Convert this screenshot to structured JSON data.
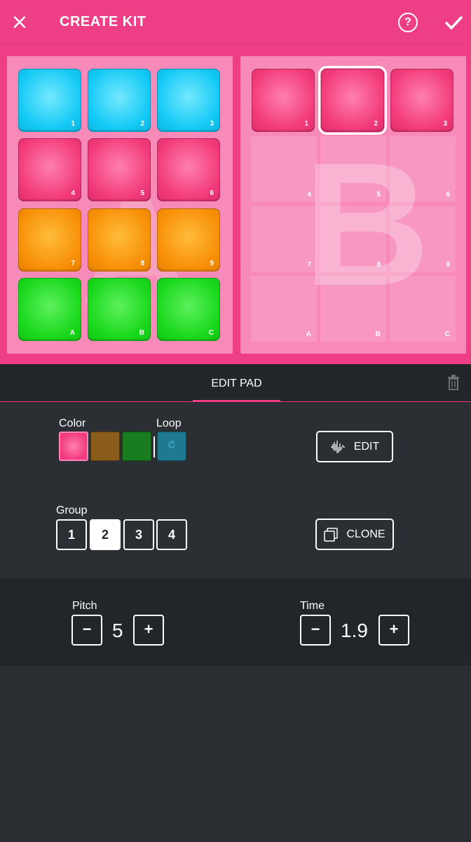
{
  "header": {
    "title": "CREATE KIT",
    "close_icon": "×",
    "help_label": "?"
  },
  "colors": {
    "brand": "#ee3f86",
    "panel": "#f78ab8",
    "blue": "#12c9f5",
    "pink": "#f23a7a",
    "orange": "#f88f07",
    "green": "#19d81b"
  },
  "panelA": {
    "letter": "A",
    "pads": [
      {
        "num": "1",
        "color": "blue"
      },
      {
        "num": "2",
        "color": "blue"
      },
      {
        "num": "3",
        "color": "blue"
      },
      {
        "num": "4",
        "color": "pink"
      },
      {
        "num": "5",
        "color": "pink"
      },
      {
        "num": "6",
        "color": "pink"
      },
      {
        "num": "7",
        "color": "orange"
      },
      {
        "num": "8",
        "color": "orange"
      },
      {
        "num": "9",
        "color": "orange"
      },
      {
        "num": "A",
        "color": "green"
      },
      {
        "num": "B",
        "color": "green"
      },
      {
        "num": "C",
        "color": "green"
      }
    ]
  },
  "panelB": {
    "letter": "B",
    "pads": [
      {
        "num": "1",
        "color": "pink"
      },
      {
        "num": "2",
        "color": "pink",
        "selected": true
      },
      {
        "num": "3",
        "color": "pink"
      },
      {
        "num": "4"
      },
      {
        "num": "5"
      },
      {
        "num": "6"
      },
      {
        "num": "7"
      },
      {
        "num": "8"
      },
      {
        "num": "9"
      },
      {
        "num": "A"
      },
      {
        "num": "B"
      },
      {
        "num": "C"
      }
    ]
  },
  "editPad": {
    "tab_label": "EDIT PAD",
    "color_label": "Color",
    "loop_label": "Loop",
    "edit_label": "EDIT",
    "group_label": "Group",
    "groups": [
      "1",
      "2",
      "3",
      "4"
    ],
    "active_group": "2",
    "clone_label": "CLONE"
  },
  "tuning": {
    "pitch_label": "Pitch",
    "pitch_value": "5",
    "time_label": "Time",
    "time_value": "1.9",
    "minus": "−",
    "plus": "+"
  }
}
